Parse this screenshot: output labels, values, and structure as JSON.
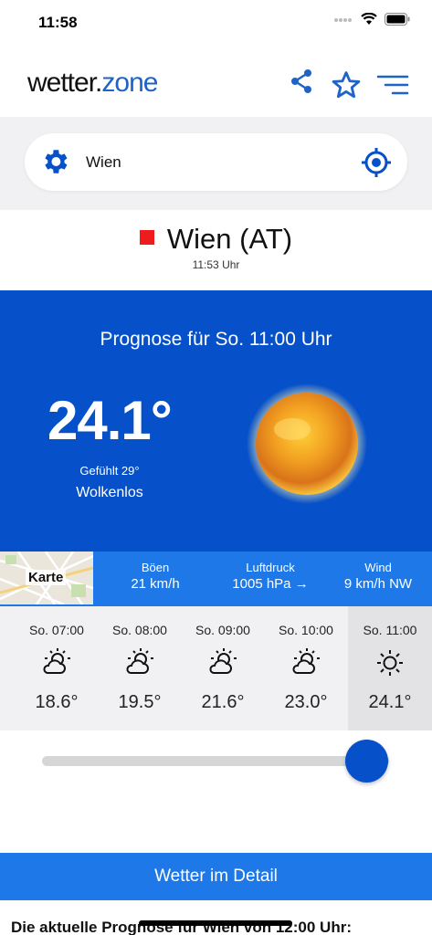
{
  "status": {
    "time": "11:58"
  },
  "header": {
    "logo_part1": "wetter",
    "logo_dot": ".",
    "logo_part2": "zone"
  },
  "search": {
    "value": "Wien"
  },
  "location": {
    "name": "Wien (AT)",
    "time": "11:53 Uhr",
    "marker_color": "#ee1c1c"
  },
  "forecast": {
    "title": "Prognose für So. 11:00 Uhr",
    "temperature": "24.1°",
    "feels_like": "Gefühlt 29°",
    "condition": "Wolkenlos",
    "icon": "sun-icon"
  },
  "info": {
    "map_label": "Karte",
    "items": [
      {
        "label": "Böen",
        "value": "21 km/h"
      },
      {
        "label": "Luftdruck",
        "value": "1005 hPa →"
      },
      {
        "label": "Wind",
        "value": "9 km/h NW"
      }
    ]
  },
  "hours": [
    {
      "time": "So. 07:00",
      "icon": "partly-cloudy-sun-icon",
      "temp": "18.6°"
    },
    {
      "time": "So. 08:00",
      "icon": "partly-cloudy-sun-icon",
      "temp": "19.5°"
    },
    {
      "time": "So. 09:00",
      "icon": "partly-cloudy-sun-icon",
      "temp": "21.6°"
    },
    {
      "time": "So. 10:00",
      "icon": "partly-cloudy-sun-icon",
      "temp": "23.0°"
    },
    {
      "time": "So. 11:00",
      "icon": "sun-icon",
      "temp": "24.1°"
    }
  ],
  "slider": {
    "value": 1.0
  },
  "detail_button": "Wetter im Detail",
  "bottom_text": "Die aktuelle Prognose für Wien von 12:00 Uhr:",
  "colors": {
    "brand_blue": "#0650c9",
    "accent_blue": "#1e78e8",
    "logo_blue": "#1e64c8"
  }
}
